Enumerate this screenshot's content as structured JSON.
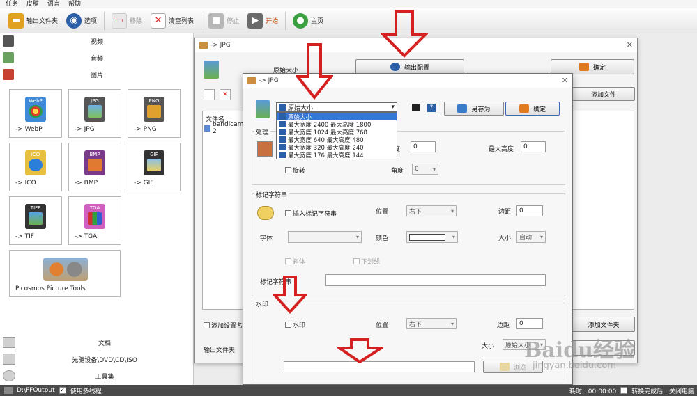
{
  "menubar": {
    "items": [
      "任务",
      "皮肤",
      "语言",
      "帮助"
    ]
  },
  "toolbar": {
    "output_folder": "输出文件夹",
    "options": "选项",
    "remove": "移除",
    "clear_list": "清空列表",
    "stop": "停止",
    "start": "开始",
    "home": "主页"
  },
  "left_panel": {
    "categories": {
      "video": "视频",
      "audio": "音频",
      "image": "图片"
    },
    "tiles": {
      "webp": {
        "label": "-> WebP",
        "badge": "WebP"
      },
      "jpg": {
        "label": "-> JPG",
        "badge": "JPG"
      },
      "png": {
        "label": "-> PNG",
        "badge": "PNG"
      },
      "ico": {
        "label": "-> ICO",
        "badge": "ICO"
      },
      "bmp": {
        "label": "-> BMP",
        "badge": "BMP"
      },
      "gif": {
        "label": "-> GIF",
        "badge": "GIF"
      },
      "tif": {
        "label": "-> TIF",
        "badge": "TIFF"
      },
      "tga": {
        "label": "-> TGA",
        "badge": "TGA"
      },
      "picosmos": {
        "label": "Picosmos Picture Tools"
      }
    },
    "bottom": {
      "document": "文档",
      "optical": "光驱设备\\DVD\\CD\\ISO",
      "toolset": "工具集"
    }
  },
  "status_bar": {
    "output_path": "D:\\FFOutput",
    "multithread": "使用多线程",
    "time": "耗时 : 00:00:00",
    "after_done": "转换完成后 : 关闭电脑"
  },
  "window1": {
    "title": "-> JPG",
    "original_size": "原始大小",
    "output_config": "输出配置",
    "ok": "确定",
    "add_file": "添加文件",
    "file_name_header": "文件名",
    "file_row": "bandicam 2",
    "add_settings": "添加设置名",
    "add_folder": "添加文件夹",
    "output_folder": "输出文件夹"
  },
  "window2": {
    "title": "-> JPG",
    "save_as": "另存为",
    "ok": "确定",
    "dropdown": {
      "value": "原始大小",
      "options": [
        "原始大小",
        "最大宽度 2400 最大高度 1800",
        "最大宽度 1024 最大高度 768",
        "最大宽度 640 最大高度 480",
        "最大宽度 320 最大高度 240",
        "最大宽度 176 最大高度 144"
      ]
    },
    "process": {
      "title": "处理",
      "width_label": "度",
      "width_value": "0",
      "max_height_label": "最大高度",
      "max_height_value": "0",
      "rotate": "旋转",
      "angle_label": "角度",
      "angle_value": "0"
    },
    "marker": {
      "title": "标记字符串",
      "insert": "插入标记字符串",
      "position_label": "位置",
      "position_value": "右下",
      "margin_label": "边距",
      "margin_value": "0",
      "font_label": "字体",
      "color_label": "颜色",
      "size_label": "大小",
      "size_value": "自动",
      "italic": "斜体",
      "underline": "下划线",
      "string_label": "标记字符串"
    },
    "watermark": {
      "title": "水印",
      "checkbox": "水印",
      "position_label": "位置",
      "position_value": "右下",
      "margin_label": "边距",
      "margin_value": "0",
      "size_label": "大小",
      "size_value": "原始大小",
      "browse": "浏览"
    }
  },
  "baidu_watermark": {
    "text": "Baidu经验",
    "url": "jingyan.baidu.com"
  },
  "colors": {
    "arrow_red": "#d42020",
    "selection_blue": "#3875d7",
    "status_bar": "#4a4a4a"
  }
}
